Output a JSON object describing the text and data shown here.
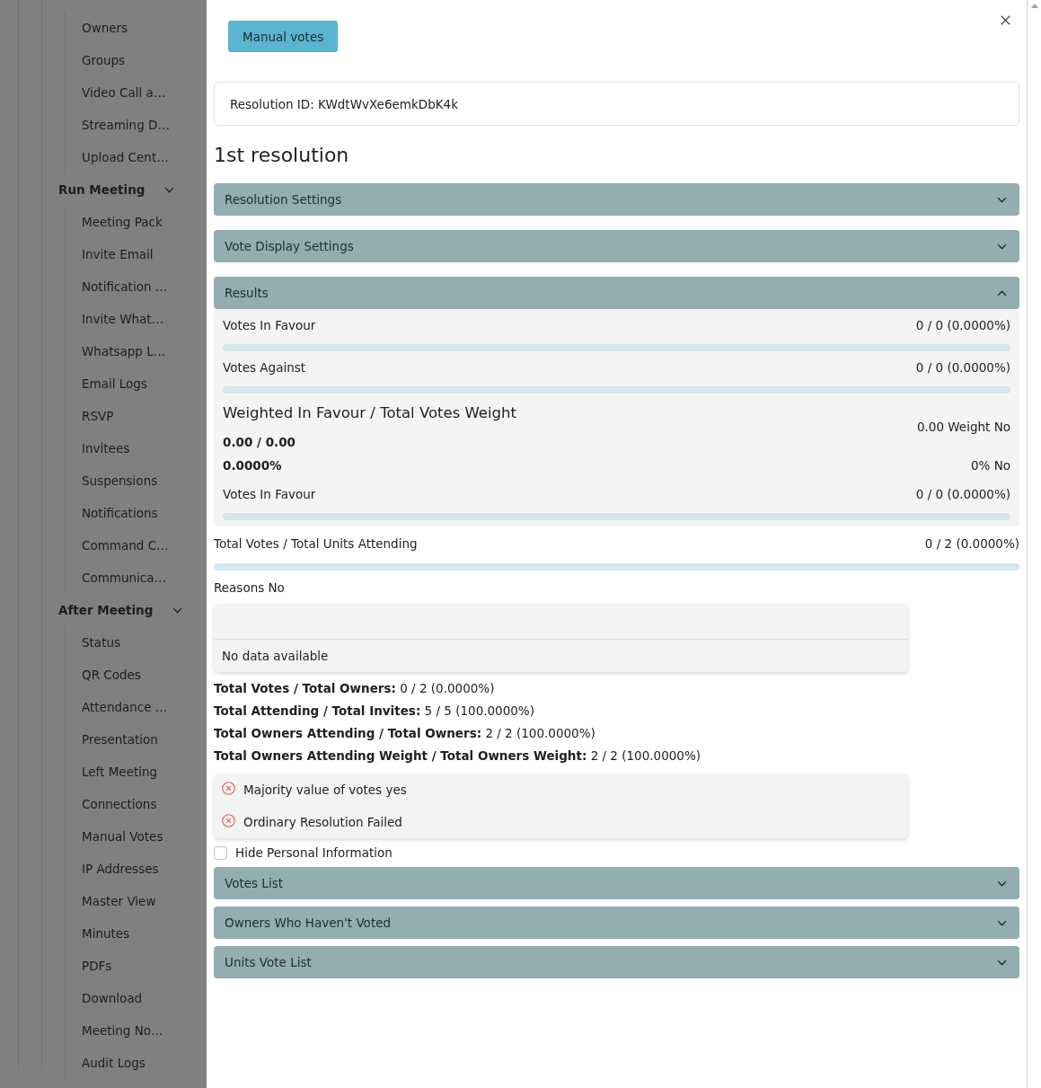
{
  "sidebar": {
    "items": [
      {
        "kind": "link",
        "label": "Owners"
      },
      {
        "kind": "link",
        "label": "Groups"
      },
      {
        "kind": "link",
        "label": "Video Call a…"
      },
      {
        "kind": "link",
        "label": "Streaming D…"
      },
      {
        "kind": "link",
        "label": "Upload Cent…"
      },
      {
        "kind": "section",
        "label": "Run Meeting",
        "expanded": true,
        "children": [
          {
            "label": "Meeting Pack"
          },
          {
            "label": "Invite Email"
          },
          {
            "label": "Notification …"
          },
          {
            "label": "Invite What…"
          },
          {
            "label": "Whatsapp L…"
          },
          {
            "label": "Email Logs"
          },
          {
            "label": "RSVP"
          },
          {
            "label": "Invitees"
          },
          {
            "label": "Suspensions"
          },
          {
            "label": "Notifications"
          },
          {
            "label": "Command C…"
          },
          {
            "label": "Communica…"
          }
        ]
      },
      {
        "kind": "section",
        "label": "After Meeting",
        "expanded": true,
        "children": [
          {
            "label": "Status"
          },
          {
            "label": "QR Codes"
          },
          {
            "label": "Attendance …"
          },
          {
            "label": "Presentation"
          },
          {
            "label": "Left Meeting"
          },
          {
            "label": "Connections"
          },
          {
            "label": "Manual Votes"
          },
          {
            "label": "IP Addresses"
          },
          {
            "label": "Master View"
          },
          {
            "label": "Minutes"
          },
          {
            "label": "PDFs"
          },
          {
            "label": "Download"
          },
          {
            "label": "Meeting No…"
          },
          {
            "label": "Audit Logs"
          }
        ]
      }
    ]
  },
  "dialog": {
    "action_button": "Manual votes",
    "resolution_id": "Resolution ID: KWdtWvXe6emkDbK4k",
    "title": "1st resolution",
    "panels": [
      {
        "title": "Resolution Settings",
        "expanded": false
      },
      {
        "title": "Vote Display Settings",
        "expanded": false
      },
      {
        "title": "Results",
        "expanded": true,
        "rows": [
          {
            "kind": "bar",
            "label": "Votes In Favour",
            "reading": "0 / 0 (0.0000%)",
            "level": 0
          },
          {
            "kind": "bar",
            "label": "Votes Against",
            "reading": "0 / 0 (0.0000%)",
            "level": 0
          },
          {
            "kind": "weighted",
            "heading": "Weighted In Favour / Total Votes Weight",
            "ratio": "0.00 / 0.00",
            "percent": "0.0000%",
            "weight_no": "0.00 Weight No",
            "percent_no": "0% No"
          },
          {
            "kind": "bar",
            "label": "Votes In Favour",
            "reading": "0 / 0 (0.0000%)",
            "level": 0
          }
        ]
      }
    ],
    "units_attending": {
      "label": "Total Votes / Total Units Attending",
      "reading": "0 / 2 (0.0000%)",
      "level": 0
    },
    "reasons_no": {
      "label": "Reasons No",
      "empty_text": "No data available"
    },
    "totals": [
      "**Total Votes / Total Owners:** 0 / 2 (0.0000%)",
      "**Total Attending / Total Invites:** 5 / 5 (100.0000%)",
      "**Total Owners Attending / Total Owners:** 2 / 2 (100.0000%)",
      "**Total Owners Attending Weight / Total Owners Weight:** 2 / 2 (100.0000%)"
    ],
    "outcomes": [
      {
        "text": "Majority value of votes yes",
        "passed": false
      },
      {
        "text": "Ordinary Resolution Failed",
        "passed": false
      }
    ],
    "hide_personal_information": {
      "label": "Hide Personal Information",
      "checked": false
    },
    "lists": [
      {
        "title": "Votes List",
        "expanded": false
      },
      {
        "title": "Owners Who Haven't Voted",
        "expanded": false
      },
      {
        "title": "Units Vote List",
        "expanded": false
      }
    ]
  }
}
